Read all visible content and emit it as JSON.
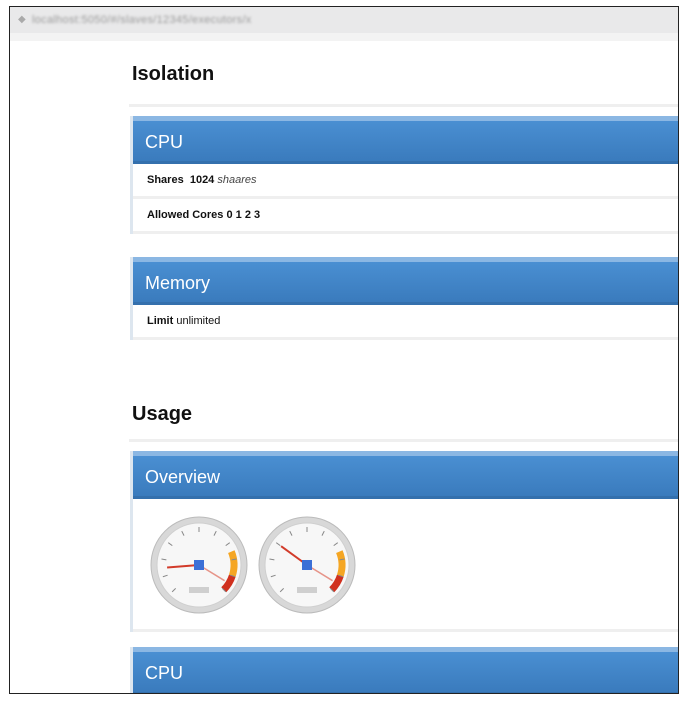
{
  "browser": {
    "address_text": "localhost:5050/#/slaves/12345/executors/x",
    "icon": "page-icon"
  },
  "isolation": {
    "heading": "Isolation",
    "cpu": {
      "title": "CPU",
      "shares_label": "Shares",
      "shares_value": "1024",
      "shares_unit": "shaares",
      "cores_label": "Allowed Cores",
      "cores_value": "0 1 2 3"
    },
    "memory": {
      "title": "Memory",
      "limit_label": "Limit",
      "limit_value": "unlimited"
    }
  },
  "usage": {
    "heading": "Usage",
    "overview": {
      "title": "Overview",
      "gauges": [
        {
          "level": 0.15
        },
        {
          "level": 0.3
        }
      ]
    },
    "cpu": {
      "title": "CPU"
    }
  },
  "colors": {
    "panel_header": "#3f84c7",
    "gauge_orange": "#f5a623",
    "gauge_red": "#d0301e"
  }
}
